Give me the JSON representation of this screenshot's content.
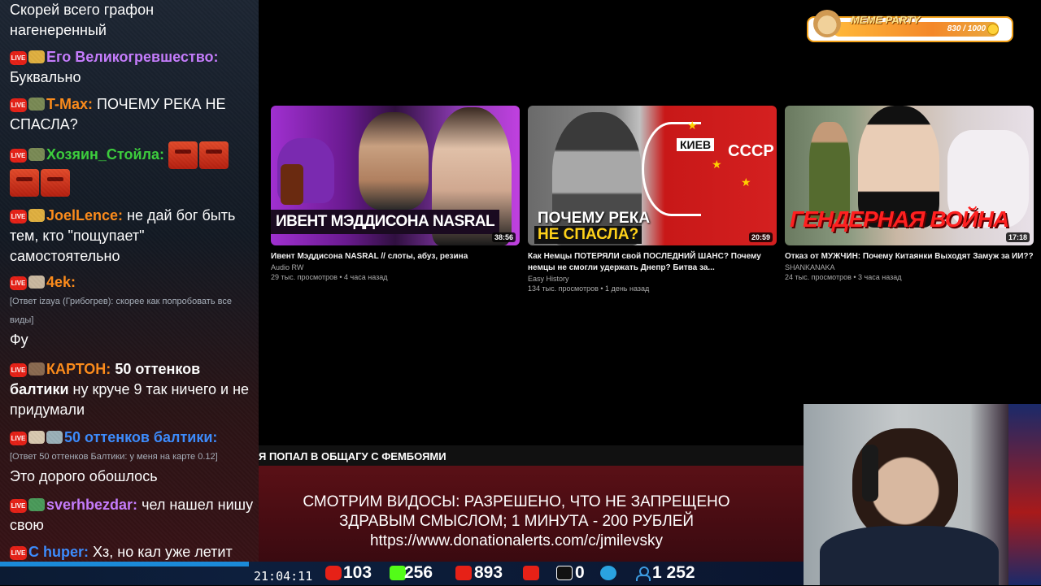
{
  "chat": {
    "messages": [
      {
        "text": "Скорей всего графон нагенеренный"
      },
      {
        "nick": "Его Великогревшество:",
        "text": "Буквально"
      },
      {
        "nick": "T-Max:",
        "text": "ПОЧЕМУ РЕКА НЕ СПАСЛА?"
      },
      {
        "nick": "Хозяин_Стойла:"
      },
      {
        "nick": "JoelLence:",
        "text": "не дай бог быть тем, кто \"пощупает\" самостоятельно"
      },
      {
        "nick": "4ek:",
        "reply": "[Ответ izaya (Грибогрев): скорее как попробовать все виды]",
        "text": "Фу"
      },
      {
        "nick": "КАРТОН:",
        "text_bold": "50 оттенков балтики",
        "text": " ну круче 9 так ничего и не придумали"
      },
      {
        "nick": "50 оттенков балтики:",
        "reply": "[Ответ 50 оттенков Балтики: у меня на карте 0.12]",
        "text": "Это дорого обошлось"
      },
      {
        "nick": "sverhbezdar:",
        "text": "чел нашел нишу свою"
      },
      {
        "nick": "C huper:",
        "text": "Хз, но кал уже летит ему на усы"
      }
    ]
  },
  "videos": [
    {
      "thumb_text": "ИВЕНТ МЭДДИСОНА NASRAL",
      "duration": "38:56",
      "title": "Ивент Мэддисона NASRAL // слоты, абуз, резина",
      "channel": "Audio RW",
      "meta": "29 тыс. просмотров • 4 часа назад"
    },
    {
      "thumb_text_1": "ПОЧЕМУ РЕКА",
      "thumb_text_2": "НЕ СПАСЛА?",
      "map_city": "КИЕВ",
      "map_country": "СССР",
      "duration": "20:59",
      "title": "Как Немцы ПОТЕРЯЛИ свой ПОСЛЕДНИЙ ШАНС? Почему немцы не смогли удержать Днепр? Битва за...",
      "channel": "Easy History",
      "meta": "134 тыс. просмотров • 1 день назад"
    },
    {
      "thumb_text": "ГЕНДЕРНАЯ ВОЙНА",
      "duration": "17:18",
      "title": "Отказ от МУЖЧИН: Почему Китаянки Выходят Замуж за ИИ??",
      "channel": "SHANKANAKA",
      "meta": "24 тыс. просмотров • 3 часа назад"
    }
  ],
  "meme_party": {
    "label": "MEME PARTY",
    "progress": "830 / 1000",
    "progress_fraction": 0.83
  },
  "ticker": "Я ПОПАЛ В ОБЩАГУ С ФЕМБОЯМИ",
  "banner": {
    "line1": "СМОТРИМ ВИДОСЫ: РАЗРЕШЕНО, ЧТО НЕ ЗАПРЕЩЕНО",
    "line2": "ЗДРАВЫМ СМЫСЛОМ; 1 МИНУТА - 200 РУБЛЕЙ",
    "line3": "https://www.donationalerts.com/c/jmilevsky"
  },
  "status": {
    "time": "21:04:11",
    "youtube": "103",
    "kick": "256",
    "vklive": "893",
    "rutube": "0",
    "viewers": "1 252"
  },
  "colors": {
    "live_red": "#e62117",
    "nick_purple": "#c77dff",
    "nick_orange": "#ff8c1a",
    "nick_green": "#3ccf3c",
    "nick_blue": "#3c8cff"
  }
}
